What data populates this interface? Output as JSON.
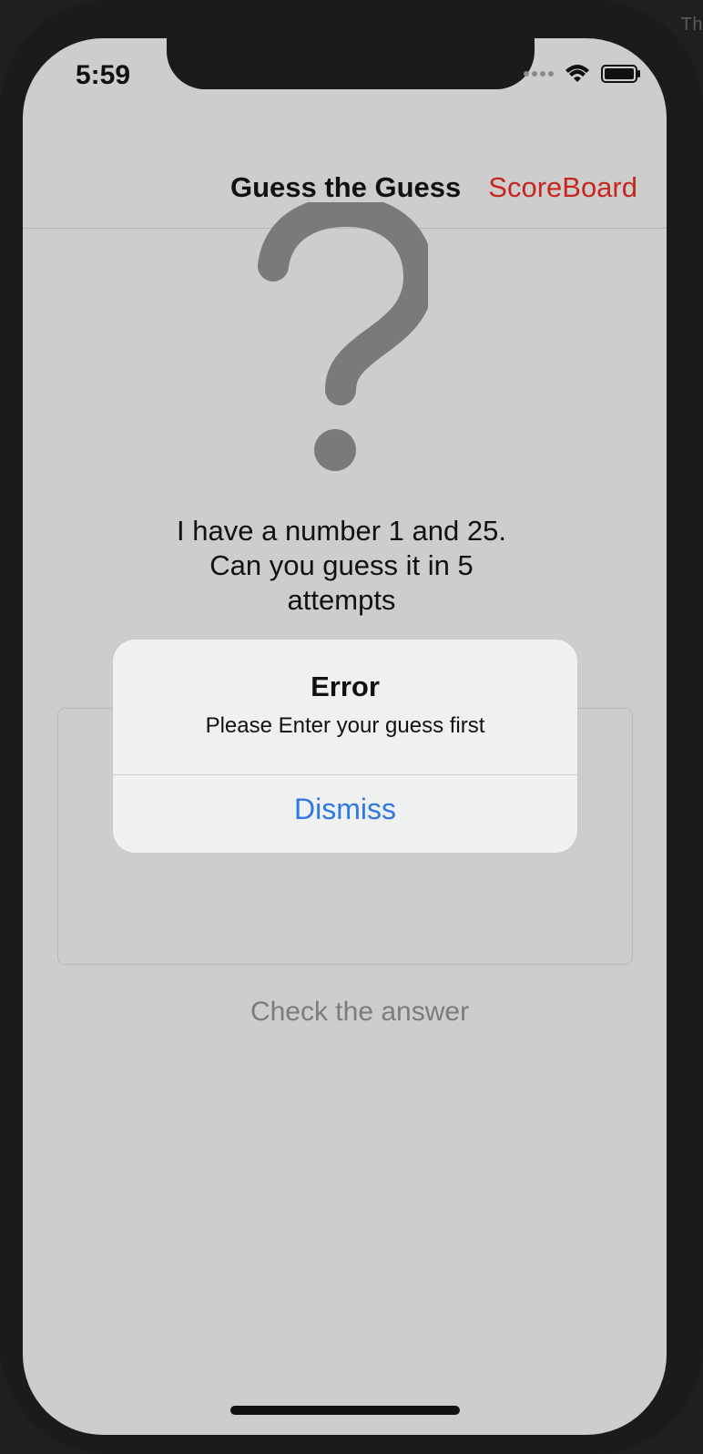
{
  "corner_text": "Th",
  "status_bar": {
    "time": "5:59"
  },
  "navbar": {
    "title": "Guess the Guess",
    "right_button": "ScoreBoard"
  },
  "hero": {
    "icon": "question-mark-icon"
  },
  "prompt": {
    "line1": "I have a number 1 and 25.",
    "line2": "Can you guess it in 5",
    "line3": "attempts"
  },
  "input": {
    "value": "",
    "placeholder": ""
  },
  "actions": {
    "check_label": "Check the answer"
  },
  "alert": {
    "title": "Error",
    "message": "Please Enter your guess first",
    "button": "Dismiss"
  },
  "colors": {
    "accent": "#c7261e",
    "link_blue": "#2f79e5",
    "screen_bg": "#cdcdcd"
  }
}
